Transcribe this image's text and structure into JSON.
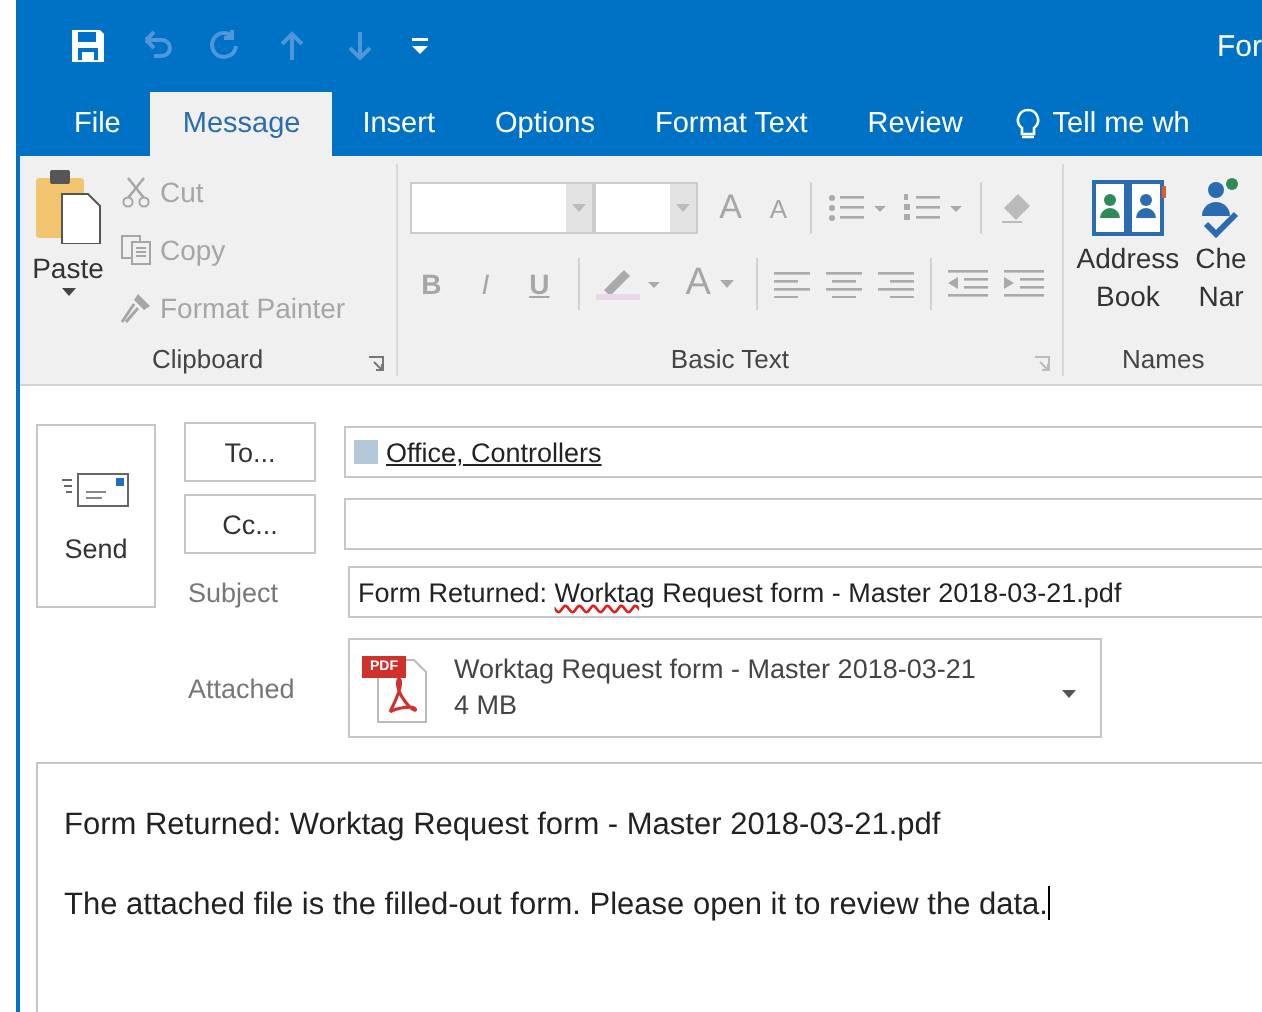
{
  "window": {
    "title": "For"
  },
  "quick_access": [
    {
      "kind": "save",
      "disabled": false
    },
    {
      "kind": "undo",
      "disabled": true
    },
    {
      "kind": "redo",
      "disabled": true
    },
    {
      "kind": "up",
      "disabled": true
    },
    {
      "kind": "down",
      "disabled": true
    },
    {
      "kind": "customize",
      "disabled": false
    }
  ],
  "tabs": [
    {
      "label": "File",
      "selected": false
    },
    {
      "label": "Message",
      "selected": true
    },
    {
      "label": "Insert",
      "selected": false
    },
    {
      "label": "Options",
      "selected": false
    },
    {
      "label": "Format Text",
      "selected": false
    },
    {
      "label": "Review",
      "selected": false
    }
  ],
  "tell_me": "Tell me wh",
  "clipboard": {
    "label": "Clipboard",
    "paste": "Paste",
    "items": [
      {
        "kind": "cut",
        "label": "Cut",
        "disabled": true
      },
      {
        "kind": "copy",
        "label": "Copy",
        "disabled": true
      },
      {
        "kind": "painter",
        "label": "Format Painter",
        "disabled": true
      }
    ]
  },
  "basic_text": {
    "label": "Basic Text",
    "size_glyphs": [
      "A",
      "A"
    ],
    "format_glyphs": [
      "B",
      "I",
      "U"
    ],
    "color_glyph": "A"
  },
  "names": {
    "label": "Names",
    "buttons": [
      {
        "kind": "book",
        "lines": [
          "Address",
          "Book"
        ]
      },
      {
        "kind": "check",
        "lines": [
          "Che",
          "Nar"
        ]
      }
    ]
  },
  "compose": {
    "send": "Send",
    "to_button": "To...",
    "to_value": "Office, Controllers",
    "cc_button": "Cc...",
    "subject_label": "Subject",
    "subject": [
      {
        "text": "Form Returned: ",
        "misspelled": false
      },
      {
        "text": "Worktag",
        "misspelled": true
      },
      {
        "text": " Request form - Master 2018-03-21.pdf",
        "misspelled": false
      }
    ],
    "attached_label": "Attached",
    "attachment": {
      "badge": "PDF",
      "name": "Worktag Request form - Master 2018-03-21",
      "size": "4 MB"
    }
  },
  "body": [
    "Form Returned: Worktag Request form - Master 2018-03-21.pdf",
    "The attached file is the filled-out form. Please open it to review the data."
  ]
}
